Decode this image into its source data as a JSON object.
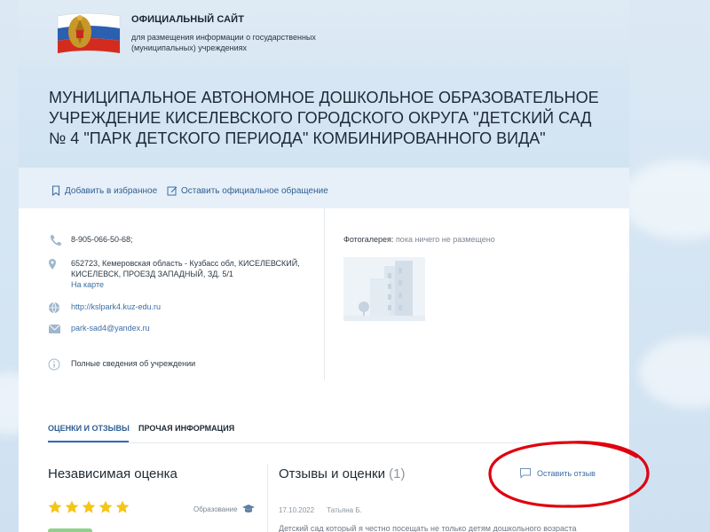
{
  "header": {
    "site_title": "ОФИЦИАЛЬНЫЙ САЙТ",
    "site_subtitle": "для размещения информации о государственных (муниципальных) учреждениях",
    "emblem_icon": "russian-coat-of-arms-with-flag-icon"
  },
  "organization": {
    "name": "МУНИЦИПАЛЬНОЕ АВТОНОМНОЕ ДОШКОЛЬНОЕ ОБРАЗОВАТЕЛЬНОЕ УЧРЕЖДЕНИЕ КИСЕЛЕВСКОГО ГОРОДСКОГО ОКРУГА \"ДЕТСКИЙ САД № 4 \"ПАРК ДЕТСКОГО ПЕРИОДА\" КОМБИНИРОВАННОГО ВИДА\""
  },
  "actions": {
    "favorite_label": "Добавить в избранное",
    "appeal_label": "Оставить официальное обращение"
  },
  "contacts": {
    "phone": "8-905-066-50-68;",
    "address": "652723, Кемеровская область - Кузбасс обл, КИСЕЛЕВСКИЙ, КИСЕЛЕВСК, ПРОЕЗД ЗАПАДНЫЙ, ЗД. 5/1",
    "map_link": "На карте",
    "website": "http://kslpark4.kuz-edu.ru",
    "email": "park-sad4@yandex.ru",
    "full_info": "Полные сведения об учреждении"
  },
  "gallery": {
    "label": "Фотогалерея:",
    "empty_text": "пока ничего не размещено"
  },
  "tabs": [
    {
      "label": "ОЦЕНКИ И ОТЗЫВЫ",
      "active": true
    },
    {
      "label": "ПРОЧАЯ ИНФОРМАЦИЯ",
      "active": false
    }
  ],
  "independent_rating": {
    "title": "Независимая оценка",
    "category": "Образование",
    "stars": 5
  },
  "reviews": {
    "title": "Отзывы и оценки",
    "count": "(1)",
    "leave_review_label": "Оставить отзыв",
    "first_date": "17.10.2022",
    "first_author": "Татьяна Б.",
    "first_text_fragment": "Детский сад который я честно посещать не только детям дошкольного возраста"
  },
  "colors": {
    "accent": "#2f6fb0",
    "link": "#3b6ea5",
    "star": "#f5c518",
    "annotation": "#e0000f",
    "badge": "#8fd18a"
  }
}
